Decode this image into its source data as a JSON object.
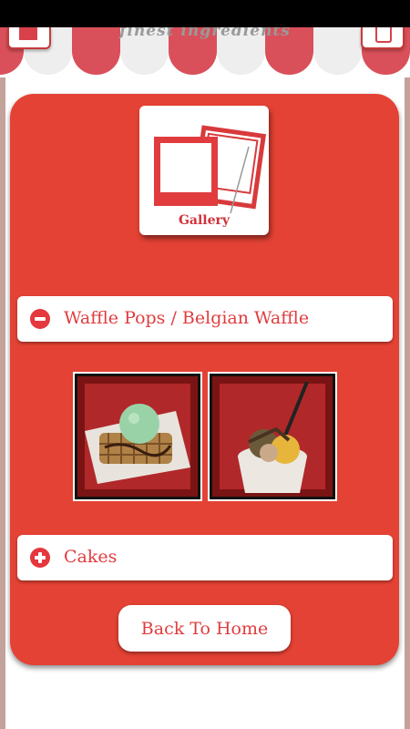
{
  "header": {
    "tagline": "finest ingredients",
    "home_icon": "home-icon",
    "phone_icon": "phone-icon"
  },
  "gallery_tile": {
    "label": "Gallery",
    "icon": "photos-icon"
  },
  "accordion": [
    {
      "title": "Waffle Pops / Belgian Waffle",
      "state": "expanded",
      "icon": "minus-icon"
    },
    {
      "title": "Cakes",
      "state": "collapsed",
      "icon": "plus-icon"
    }
  ],
  "photos": [
    {
      "subject": "waffle-with-mint-ice-cream"
    },
    {
      "subject": "cup-with-dessert"
    }
  ],
  "buttons": {
    "back_home": "Back To Home"
  },
  "colors": {
    "panel": "#e44234",
    "accent": "#e03c3e",
    "awning_red": "#d9505a",
    "awning_white": "#eeeeee"
  }
}
